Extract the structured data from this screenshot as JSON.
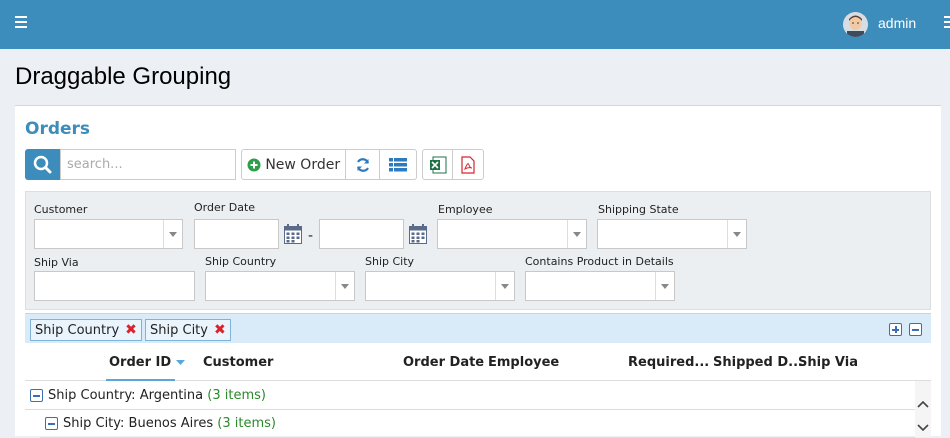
{
  "header": {
    "menu_icon": "hamburger-icon",
    "user_name": "admin",
    "right_icon": "menu-icon"
  },
  "page": {
    "title": "Draggable Grouping"
  },
  "panel": {
    "title": "Orders"
  },
  "toolbar": {
    "search_placeholder": "search...",
    "new_order_label": "New Order",
    "accent": "#3c8dbc"
  },
  "filters": {
    "customer_label": "Customer",
    "order_date_label": "Order Date",
    "date_separator": "-",
    "employee_label": "Employee",
    "shipping_state_label": "Shipping State",
    "ship_via_label": "Ship Via",
    "ship_country_label": "Ship Country",
    "ship_city_label": "Ship City",
    "contains_product_label": "Contains Product in Details"
  },
  "grouping": {
    "chips": [
      {
        "label": "Ship Country"
      },
      {
        "label": "Ship City"
      }
    ]
  },
  "grid": {
    "columns": [
      "Order ID",
      "Customer",
      "Order Date",
      "Employee",
      "Required...",
      "Shipped D...",
      "Ship Via"
    ],
    "groups": [
      {
        "label": "Ship Country: Argentina",
        "count": "(3 items)"
      },
      {
        "label": "Ship City: Buenos Aires",
        "count": "(3 items)"
      }
    ]
  }
}
